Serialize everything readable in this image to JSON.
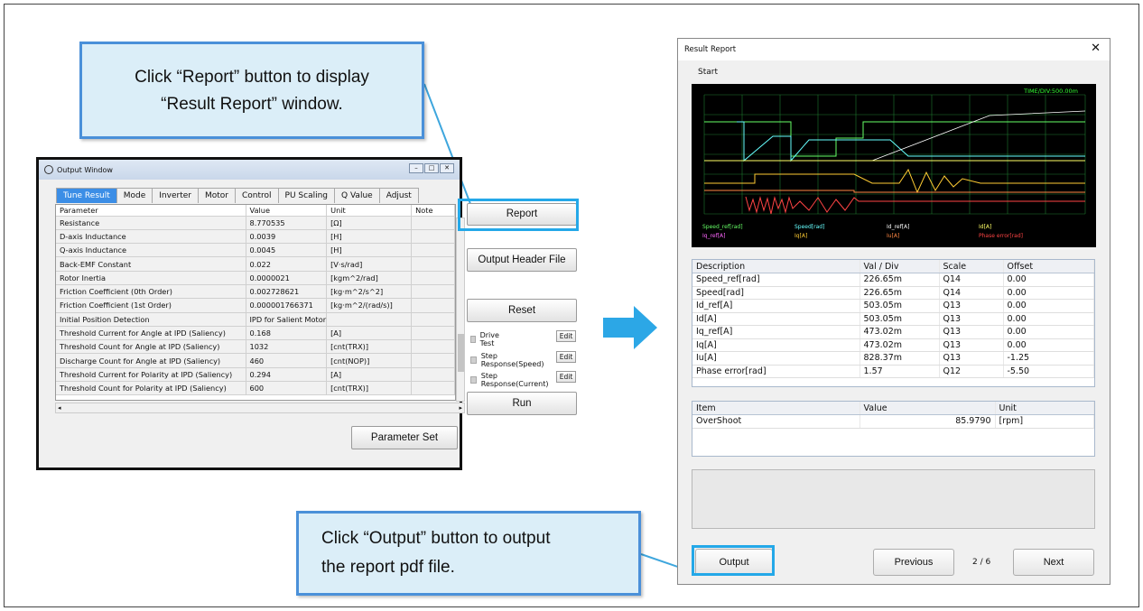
{
  "callouts": {
    "report_line1": "Click “Report” button to display",
    "report_line2": "“Result Report” window.",
    "output_line1": "Click “Output” button to output",
    "output_line2": "the report pdf file."
  },
  "output_window": {
    "title": "Output Window",
    "tabs": [
      "Tune Result",
      "Mode",
      "Inverter",
      "Motor",
      "Control",
      "PU Scaling",
      "Q Value",
      "Adjust"
    ],
    "columns": [
      "Parameter",
      "Value",
      "Unit",
      "Note"
    ],
    "rows": [
      [
        "Resistance",
        "8.770535",
        "[Ω]",
        ""
      ],
      [
        "D-axis Inductance",
        "0.0039",
        "[H]",
        ""
      ],
      [
        "Q-axis Inductance",
        "0.0045",
        "[H]",
        ""
      ],
      [
        "Back-EMF Constant",
        "0.022",
        "[V·s/rad]",
        ""
      ],
      [
        "Rotor Inertia",
        "0.0000021",
        "[kgm^2/rad]",
        ""
      ],
      [
        "Friction Coefficient (0th Order)",
        "0.002728621",
        "[kg·m^2/s^2]",
        ""
      ],
      [
        "Friction Coefficient (1st Order)",
        "0.000001766371",
        "[kg·m^2/(rad/s)]",
        ""
      ],
      [
        "Initial Position Detection",
        "IPD for Salient Motor",
        "",
        ""
      ],
      [
        "Threshold Current for Angle at IPD (Saliency)",
        "0.168",
        "[A]",
        ""
      ],
      [
        "Threshold Count for Angle at IPD (Saliency)",
        "1032",
        "[cnt(TRX)]",
        ""
      ],
      [
        "Discharge Count for Angle at IPD (Saliency)",
        "460",
        "[cnt(NOP)]",
        ""
      ],
      [
        "Threshold Current for Polarity at IPD (Saliency)",
        "0.294",
        "[A]",
        ""
      ],
      [
        "Threshold Count for Polarity at IPD (Saliency)",
        "600",
        "[cnt(TRX)]",
        ""
      ]
    ],
    "buttons": {
      "report": "Report",
      "output_header": "Output Header File",
      "reset": "Reset",
      "run": "Run",
      "parameter_set": "Parameter Set",
      "edit": "Edit"
    },
    "checks": [
      "Drive Test",
      "Step Response(Speed)",
      "Step Response(Current)"
    ]
  },
  "result_report": {
    "title": "Result Report",
    "start": "Start",
    "scope_title": "TIME/DIV:500.00m",
    "legend_row1": [
      "Speed_ref[rad]",
      "Speed[rad]",
      "Id_ref[A]",
      "Id[A]"
    ],
    "legend_row2": [
      "Iq_ref[A]",
      "Iq[A]",
      "Iu[A]",
      "Phase error[rad]"
    ],
    "legend_colors": [
      "#66ff66",
      "#66ffff",
      "#ffffff",
      "#ffff66",
      "#ff66ff",
      "#ffcc33",
      "#ff8844",
      "#ff4444"
    ],
    "desc_columns": [
      "Description",
      "Val / Div",
      "Scale",
      "Offset"
    ],
    "desc_rows": [
      [
        "Speed_ref[rad]",
        "226.65m",
        "Q14",
        "0.00"
      ],
      [
        "Speed[rad]",
        "226.65m",
        "Q14",
        "0.00"
      ],
      [
        "Id_ref[A]",
        "503.05m",
        "Q13",
        "0.00"
      ],
      [
        "Id[A]",
        "503.05m",
        "Q13",
        "0.00"
      ],
      [
        "Iq_ref[A]",
        "473.02m",
        "Q13",
        "0.00"
      ],
      [
        "Iq[A]",
        "473.02m",
        "Q13",
        "0.00"
      ],
      [
        "Iu[A]",
        "828.37m",
        "Q13",
        "-1.25"
      ],
      [
        "Phase error[rad]",
        "1.57",
        "Q12",
        "-5.50"
      ]
    ],
    "item_columns": [
      "Item",
      "Value",
      "Unit"
    ],
    "item_rows": [
      [
        "OverShoot",
        "85.9790",
        "[rpm]"
      ]
    ],
    "buttons": {
      "output": "Output",
      "previous": "Previous",
      "next": "Next"
    },
    "page": "2 / 6"
  }
}
